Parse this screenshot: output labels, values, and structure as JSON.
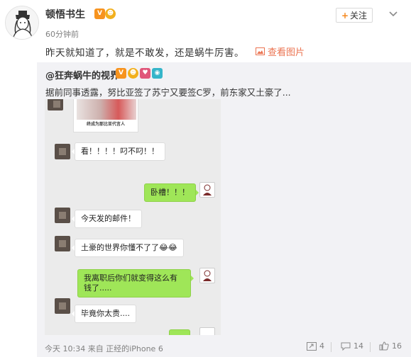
{
  "post": {
    "author": "顿悟书生",
    "time": "60分钟前",
    "follow_label": "关注",
    "follow_plus": "+",
    "text": "昨天就知道了，就是不敢发，还是蜗牛厉害。",
    "view_pictures": "查看图片"
  },
  "repost": {
    "user": "@狂奔蜗牛的视界",
    "text": "据前同事透露，努比亚签了苏宁又要签C罗，前东家又土豪了...",
    "image_caption": "终成为那比亚代言人",
    "messages": [
      {
        "side": "left",
        "text": "看！！！！叼不叼！！"
      },
      {
        "side": "right",
        "text": "卧槽！！！"
      },
      {
        "side": "left",
        "text": "今天发的邮件！"
      },
      {
        "side": "left",
        "text": "土豪的世界你懂不了了😂😂"
      },
      {
        "side": "right",
        "text": "我离职后你们就变得这么有钱了....."
      },
      {
        "side": "left",
        "text": "毕竟你太贵...."
      }
    ],
    "footer": {
      "time": "今天 10:34 来自 正经的iPhone 6",
      "reposts": "4",
      "comments": "14",
      "likes": "16"
    }
  },
  "colors": {
    "accent_orange": "#eb7350",
    "wechat_green": "#9fe658",
    "badge_orange": "#f7931e"
  },
  "icons": [
    "chevron-down-icon",
    "image-icon",
    "repost-icon",
    "comment-icon",
    "like-icon",
    "vip-badge-icon",
    "camera-icon"
  ]
}
